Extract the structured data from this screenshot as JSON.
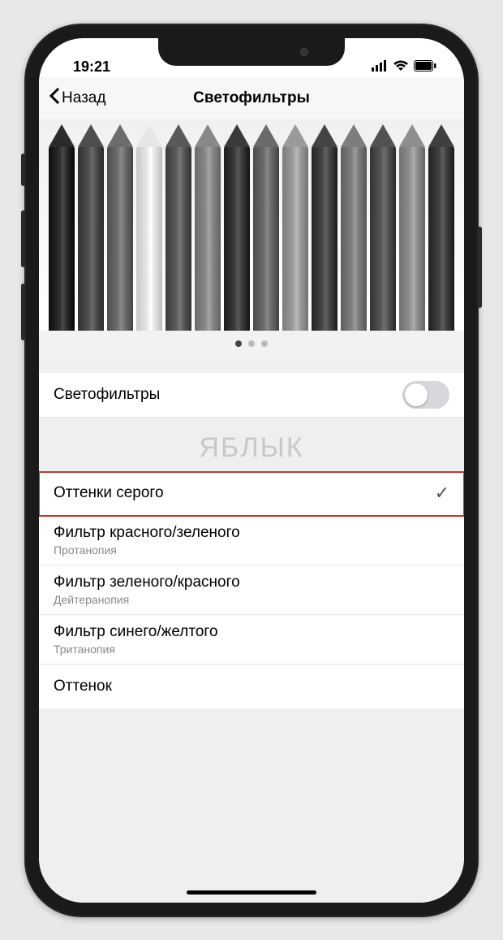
{
  "status": {
    "time": "19:21"
  },
  "nav": {
    "back": "Назад",
    "title": "Светофильтры"
  },
  "toggle_row": {
    "label": "Светофильтры",
    "state": "off"
  },
  "watermark": "ЯБЛЫК",
  "filters": [
    {
      "label": "Оттенки серого",
      "sub": "",
      "selected": true,
      "highlighted": true
    },
    {
      "label": "Фильтр красного/зеленого",
      "sub": "Протанопия",
      "selected": false
    },
    {
      "label": "Фильтр зеленого/красного",
      "sub": "Дейтеранопия",
      "selected": false
    },
    {
      "label": "Фильтр синего/желтого",
      "sub": "Тританопия",
      "selected": false
    },
    {
      "label": "Оттенок",
      "sub": "",
      "selected": false
    }
  ],
  "page_indicator": {
    "count": 3,
    "active": 0
  },
  "pencil_shades": [
    "#2b2b2b",
    "#4e4e4e",
    "#6c6c6c",
    "#e6e6e6",
    "#595959",
    "#888888",
    "#3a3a3a",
    "#6a6a6a",
    "#9a9a9a",
    "#444444",
    "#7d7d7d",
    "#525252",
    "#8e8e8e",
    "#3f3f3f"
  ]
}
